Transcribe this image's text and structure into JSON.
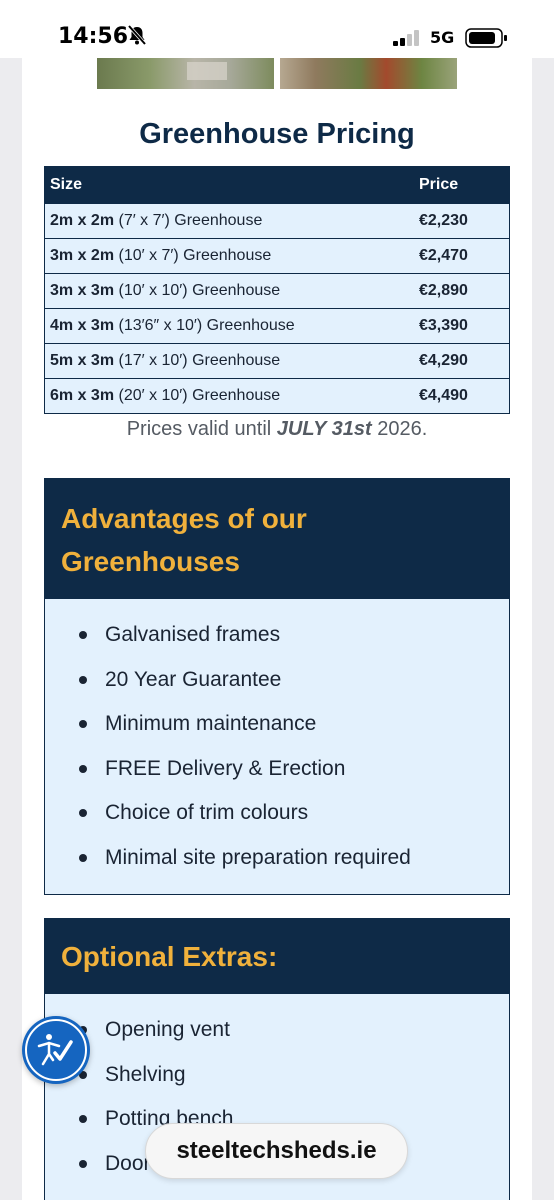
{
  "status_bar": {
    "time": "14:56",
    "network": "5G",
    "icons": [
      "bell-slash-icon",
      "signal-icon",
      "battery-icon"
    ]
  },
  "pricing": {
    "title": "Greenhouse Pricing",
    "columns": [
      "Size",
      "Price"
    ],
    "rows": [
      {
        "size_bold": "2m x 2m",
        "size_rest": " (7′ x 7′) Greenhouse",
        "price": "€2,230"
      },
      {
        "size_bold": "3m x 2m",
        "size_rest": " (10′ x 7′) Greenhouse",
        "price": "€2,470"
      },
      {
        "size_bold": "3m x 3m",
        "size_rest": " (10′ x 10′) Greenhouse",
        "price": "€2,890"
      },
      {
        "size_bold": "4m x 3m",
        "size_rest": " (13′6″ x 10′) Greenhouse",
        "price": "€3,390"
      },
      {
        "size_bold": "5m x 3m",
        "size_rest": " (17′ x 10′) Greenhouse",
        "price": "€4,290"
      },
      {
        "size_bold": "6m x 3m",
        "size_rest": " (20′ x 10′) Greenhouse",
        "price": "€4,490"
      }
    ],
    "valid_prefix": "Prices valid until ",
    "valid_date": "JULY 31st",
    "valid_suffix": " 2026."
  },
  "advantages": {
    "title_line1": "Advantages of our",
    "title_line2": "Greenhouses",
    "items": [
      "Galvanised frames",
      "20 Year Guarantee",
      "Minimum maintenance",
      "FREE Delivery & Erection",
      "Choice of trim colours",
      "Minimal site preparation required"
    ]
  },
  "extras": {
    "title": "Optional Extras:",
    "items": [
      "Opening vent",
      "Shelving",
      "Potting bench",
      "Door"
    ]
  },
  "overlay": {
    "domain": "steeltechsheds.ie",
    "accessibility_icon": "accessibility-icon"
  },
  "colors": {
    "navy": "#0e2a47",
    "accent": "#f0b13c",
    "light_blue": "#e3f1fd",
    "accessibility_blue": "#1565c0"
  }
}
